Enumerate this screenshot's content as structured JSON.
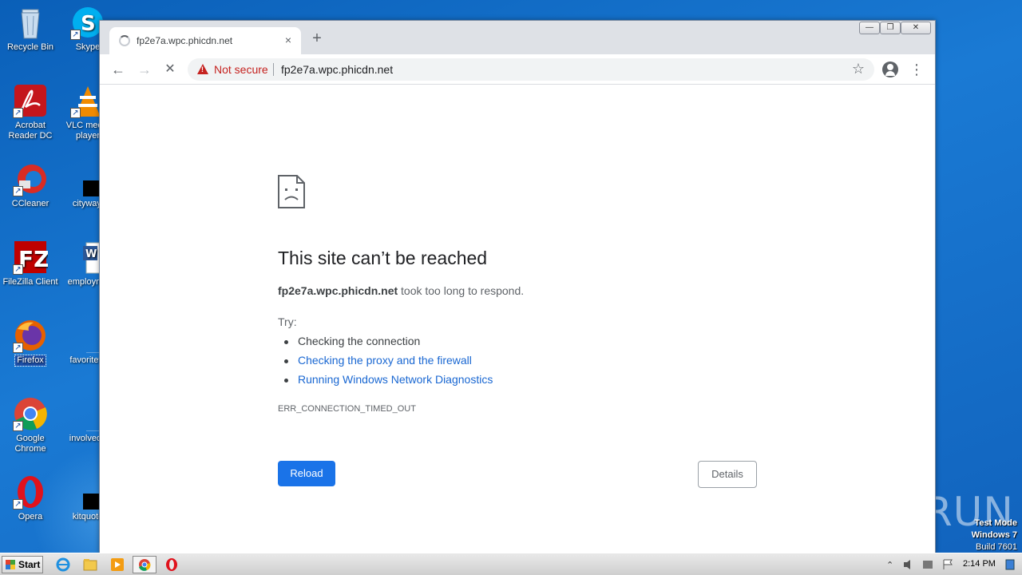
{
  "desktop": {
    "icons": [
      {
        "label": "Recycle Bin"
      },
      {
        "label": "Skype"
      },
      {
        "label": "Acrobat Reader DC"
      },
      {
        "label": "VLC media player"
      },
      {
        "label": "CCleaner"
      },
      {
        "label": "cityway."
      },
      {
        "label": "FileZilla Client"
      },
      {
        "label": "employme"
      },
      {
        "label": "Firefox"
      },
      {
        "label": "favoritefo"
      },
      {
        "label": "Google Chrome"
      },
      {
        "label": "involveda"
      },
      {
        "label": "Opera"
      },
      {
        "label": "kitquote"
      }
    ],
    "watermark": "ANY RUN",
    "test_mode": {
      "line1": "Test Mode",
      "line2": "Windows 7",
      "line3": "Build 7601"
    }
  },
  "browser": {
    "tab": {
      "title": "fp2e7a.wpc.phicdn.net",
      "close": "×"
    },
    "new_tab": "+",
    "window_controls": {
      "minimize": "—",
      "restore": "❐",
      "close": "✕"
    },
    "nav": {
      "back": "←",
      "forward": "→",
      "stop": "✕"
    },
    "omnibox": {
      "security_label": "Not secure",
      "url": "fp2e7a.wpc.phicdn.net",
      "star": "☆"
    },
    "menu": "⋮"
  },
  "error_page": {
    "title": "This site can’t be reached",
    "host": "fp2e7a.wpc.phicdn.net",
    "message": " took too long to respond.",
    "try_label": "Try:",
    "suggestions": [
      {
        "text": "Checking the connection",
        "link": false
      },
      {
        "text": "Checking the proxy and the firewall",
        "link": true
      },
      {
        "text": "Running Windows Network Diagnostics",
        "link": true
      }
    ],
    "error_code": "ERR_CONNECTION_TIMED_OUT",
    "reload_label": "Reload",
    "details_label": "Details"
  },
  "taskbar": {
    "start_label": "Start",
    "clock": "2:14 PM"
  },
  "colors": {
    "accent": "#1a73e8",
    "link": "#1967d2",
    "danger": "#c5221f",
    "desktop_bg": "#1a7ad4"
  }
}
